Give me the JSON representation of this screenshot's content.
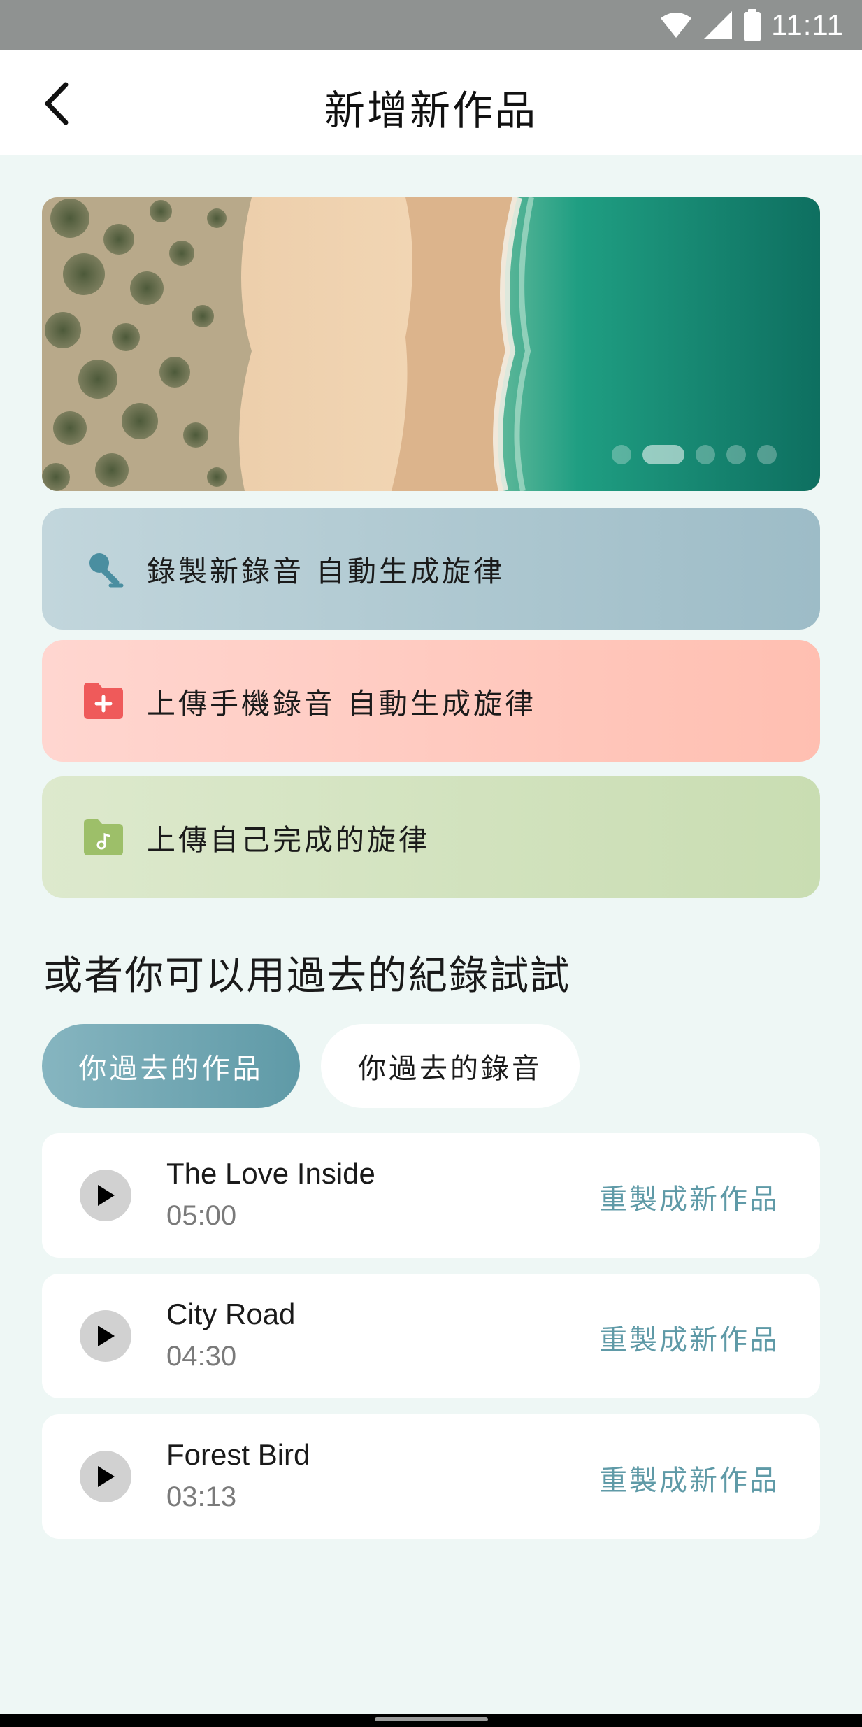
{
  "status_bar": {
    "time": "11:11",
    "icons": [
      "wifi-icon",
      "signal-icon",
      "battery-icon"
    ]
  },
  "header": {
    "title": "新增新作品",
    "back_icon": "chevron-left-icon"
  },
  "banner": {
    "image": "aerial-beach-photo",
    "dots_count": 5,
    "active_dot": 1
  },
  "actions": [
    {
      "label": "錄製新錄音 自動生成旋律",
      "icon": "microphone-icon",
      "accent": "#4a8ea0"
    },
    {
      "label": "上傳手機錄音 自動生成旋律",
      "icon": "folder-plus-icon",
      "accent": "#ef5a5a"
    },
    {
      "label": "上傳自己完成的旋律",
      "icon": "folder-music-icon",
      "accent": "#9dbf69"
    }
  ],
  "section": {
    "title": "或者你可以用過去的紀錄試試"
  },
  "tabs": [
    {
      "label": "你過去的作品",
      "active": true
    },
    {
      "label": "你過去的錄音",
      "active": false
    }
  ],
  "tracks": [
    {
      "title": "The Love Inside",
      "duration": "05:00",
      "action": "重製成新作品"
    },
    {
      "title": "City Road",
      "duration": "04:30",
      "action": "重製成新作品"
    },
    {
      "title": "Forest Bird",
      "duration": "03:13",
      "action": "重製成新作品"
    }
  ],
  "colors": {
    "background": "#eef7f5",
    "primary": "#5f9aa7",
    "status_bar": "#8f9291"
  }
}
